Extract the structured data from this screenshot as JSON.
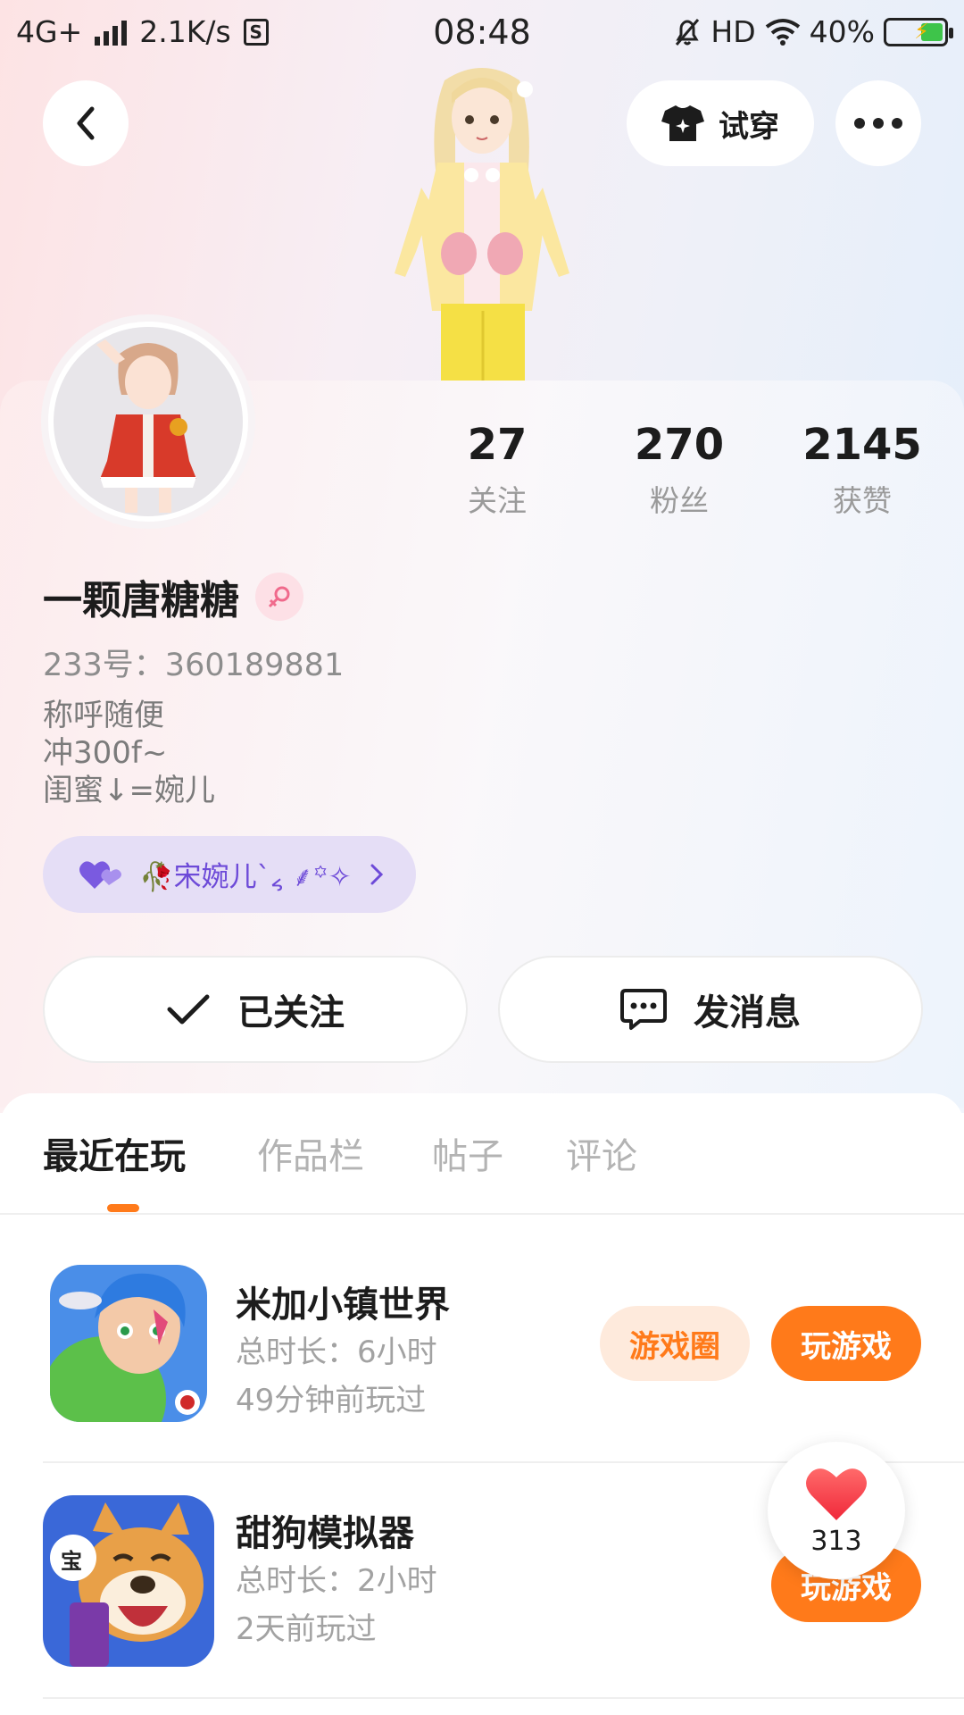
{
  "status_bar": {
    "network": "4G+",
    "speed": "2.1K/s",
    "sim_badge": "S",
    "time": "08:48",
    "hd": "HD",
    "battery": "40%"
  },
  "header": {
    "tryon_label": "试穿"
  },
  "profile": {
    "name": "一颗唐糖糖",
    "uid": "233号：360189881",
    "bio": [
      "称呼随便",
      "冲300f~",
      "闺蜜↓=婉儿"
    ],
    "cp_name": "🥀宋婉儿ˋ៹ ⸙꙳✧"
  },
  "stats": [
    {
      "num": "27",
      "label": "关注"
    },
    {
      "num": "270",
      "label": "粉丝"
    },
    {
      "num": "2145",
      "label": "获赞"
    }
  ],
  "actions": {
    "follow_label": "已关注",
    "message_label": "发消息"
  },
  "tabs": [
    "最近在玩",
    "作品栏",
    "帖子",
    "评论"
  ],
  "games": [
    {
      "title": "米加小镇世界",
      "duration": "总时长：6小时",
      "last_played": "49分钟前玩过",
      "circle_label": "游戏圈",
      "play_label": "玩游戏"
    },
    {
      "title": "甜狗模拟器",
      "duration": "总时长：2小时",
      "last_played": "2天前玩过",
      "play_label": "玩游戏",
      "icon_badge": "宝"
    }
  ],
  "like_bubble": {
    "count": "313"
  },
  "colors": {
    "accent": "#ff7a1a",
    "cp_purple": "#6d4ad8",
    "cp_bg": "#e5def6"
  }
}
